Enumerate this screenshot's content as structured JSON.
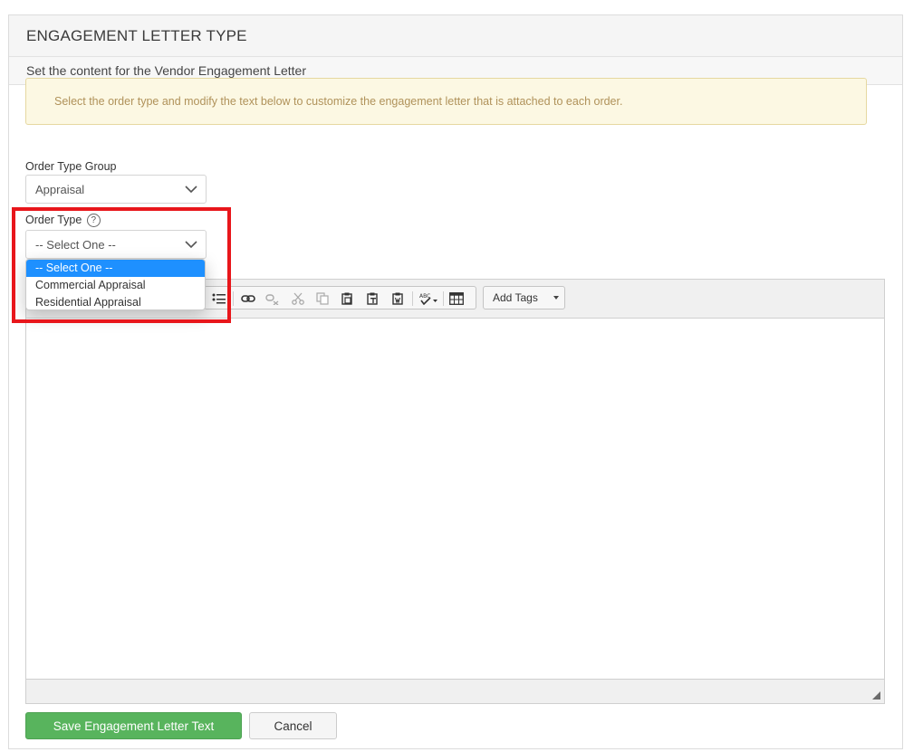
{
  "panel": {
    "title": "ENGAGEMENT LETTER TYPE",
    "subtitle": "Set the content for the Vendor Engagement Letter"
  },
  "alert": {
    "text": "Select the order type and modify the text below to customize the engagement letter that is attached to each order."
  },
  "order_type_group": {
    "label": "Order Type Group",
    "value": "Appraisal"
  },
  "order_type": {
    "label": "Order Type",
    "help": "?",
    "value": "-- Select One --",
    "options": [
      "-- Select One --",
      "Commercial Appraisal",
      "Residential Appraisal"
    ],
    "selected_index": 0
  },
  "toolbar": {
    "add_tags_label": "Add Tags",
    "icons": [
      "bulleted-list-icon",
      "link-icon",
      "unlink-icon",
      "cut-icon",
      "copy-icon",
      "paste-icon",
      "paste-text-icon",
      "paste-word-icon",
      "spellcheck-icon",
      "table-icon"
    ]
  },
  "actions": {
    "save_label": "Save Engagement Letter Text",
    "cancel_label": "Cancel"
  },
  "colors": {
    "highlight": "#e8161b",
    "save_button": "#58b45d",
    "selected_option": "#1e90ff",
    "alert_bg": "#fcf8e3"
  }
}
